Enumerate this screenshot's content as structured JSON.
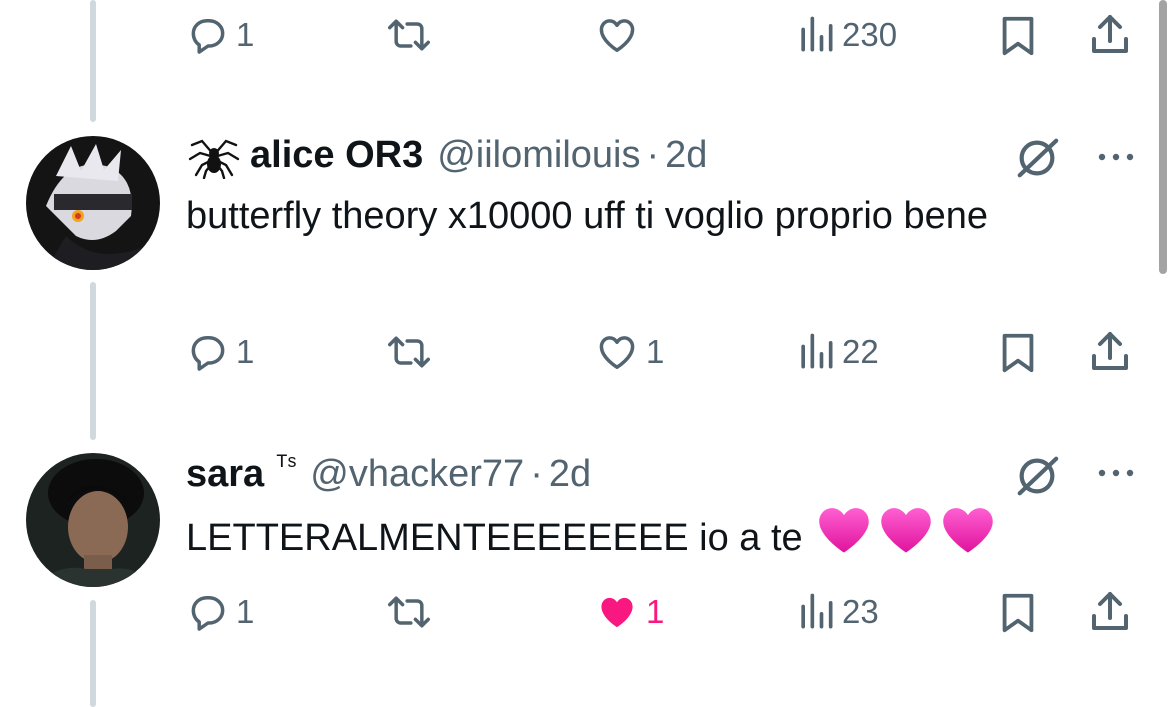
{
  "tweets": [
    {
      "name": "",
      "handle": "",
      "time": "",
      "text": "",
      "replies": "1",
      "retweets": "",
      "likes": "",
      "views": "230",
      "liked": false
    },
    {
      "badge": "spider-emoji",
      "name": "alice OR3",
      "handle": "@iilomilouis",
      "separator": "·",
      "time": "2d",
      "text": "butterfly theory x10000 uff ti voglio proprio bene",
      "replies": "1",
      "retweets": "",
      "likes": "1",
      "views": "22",
      "liked": false
    },
    {
      "name": "sara",
      "name_suffix": "ᵀˢ",
      "handle": "@vhacker77",
      "separator": "·",
      "time": "2d",
      "text": "LETTERALMENTEEEEEEEE io a te",
      "text_emojis": [
        "pink-heart-emoji",
        "pink-heart-emoji",
        "pink-heart-emoji"
      ],
      "replies": "1",
      "retweets": "",
      "likes": "1",
      "views": "23",
      "liked": true
    }
  ],
  "colors": {
    "text": "#0f1419",
    "muted": "#536471",
    "like": "#f91880",
    "thread_line": "#cfd9de"
  },
  "icons": [
    "reply-icon",
    "retweet-icon",
    "like-icon",
    "views-icon",
    "bookmark-icon",
    "share-icon",
    "grok-icon",
    "more-icon"
  ]
}
